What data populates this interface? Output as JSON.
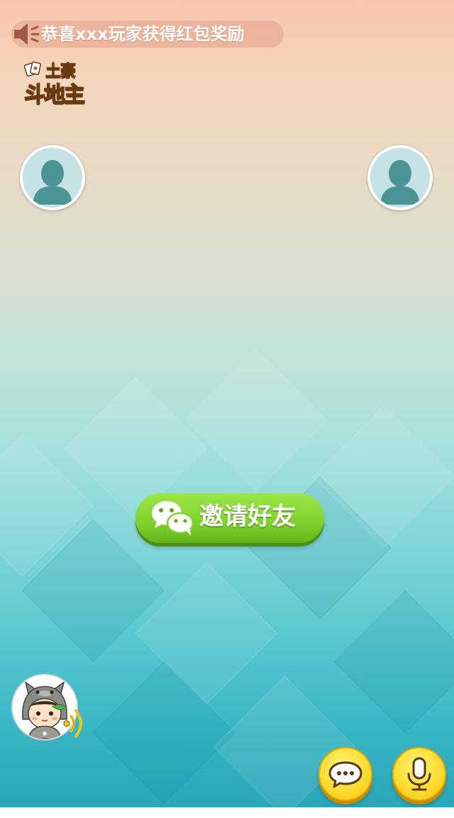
{
  "notice": {
    "text": "恭喜xxx玩家获得红包奖励",
    "icon": "speaker-icon"
  },
  "logo": {
    "line1": "土豪",
    "line2": "斗地主",
    "icon": "playing-cards-icon"
  },
  "players": [
    {
      "slot": "left",
      "icon": "default-avatar-icon"
    },
    {
      "slot": "right",
      "icon": "default-avatar-icon"
    }
  ],
  "invite": {
    "label": "邀请好友",
    "icon": "wechat-icon"
  },
  "self": {
    "icon": "character-avatar-icon",
    "voice_icon": "sound-waves-icon"
  },
  "actions": {
    "chat_icon": "chat-bubble-icon",
    "mic_icon": "microphone-icon"
  },
  "colors": {
    "invite_green": "#7fd12c",
    "button_yellow": "#ffe13a",
    "notice_bg": "#e29680"
  }
}
